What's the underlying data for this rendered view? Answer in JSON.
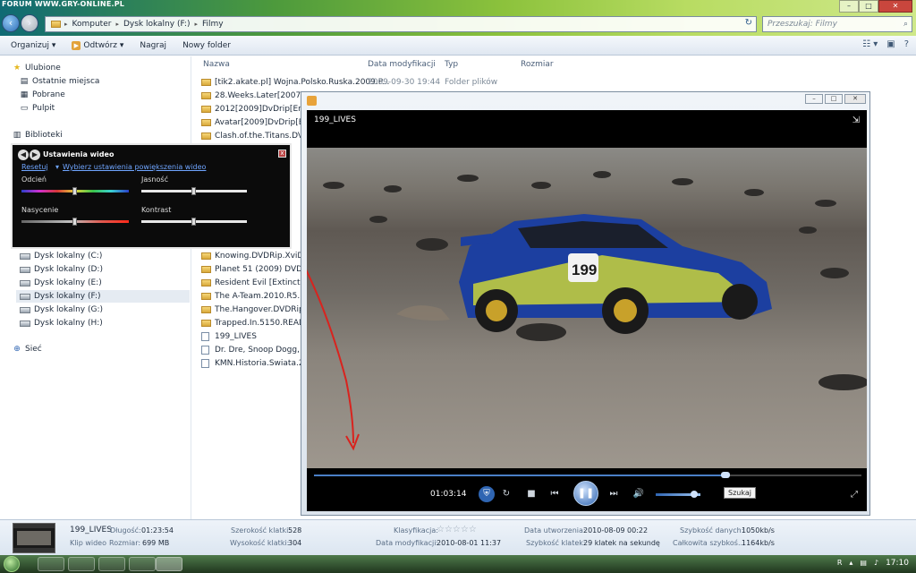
{
  "explorer": {
    "watermark": "FORUM WWW.GRY-ONLINE.PL",
    "breadcrumb": [
      "Komputer",
      "Dysk lokalny (F:)",
      "Filmy"
    ],
    "search_placeholder": "Przeszukaj: Filmy",
    "window_controls": [
      "–",
      "□",
      "✕"
    ],
    "toolbar": {
      "organize": "Organizuj ▾",
      "open": "Odtwórz ▾",
      "burn": "Nagraj",
      "new_folder": "Nowy folder"
    },
    "navpane": {
      "favorites": "Ulubione",
      "recent": "Ostatnie miejsca",
      "downloads": "Pobrane",
      "desktop": "Pulpit",
      "libraries": "Biblioteki",
      "drives": [
        "Dysk lokalny (C:)",
        "Dysk lokalny (D:)",
        "Dysk lokalny (E:)",
        "Dysk lokalny (F:)",
        "Dysk lokalny (G:)",
        "Dysk lokalny (H:)"
      ],
      "network": "Sieć"
    },
    "columns": {
      "name": "Nazwa",
      "modified": "Data modyfikacji",
      "type": "Typ",
      "size": "Rozmiar"
    },
    "files": [
      {
        "name": "[tik2.akate.pl] Wojna.Polsko.Ruska.2009.P...",
        "date": "2009-09-30 19:44",
        "type": "Folder plików",
        "kind": "folder"
      },
      {
        "name": "28.Weeks.Later[2007]DvDr",
        "date": "",
        "type": "",
        "kind": "folder"
      },
      {
        "name": "2012[2009]DvDrip[Eng]-F)",
        "date": "",
        "type": "",
        "kind": "folder"
      },
      {
        "name": "Avatar[2009]DvDrip[Eng]-",
        "date": "",
        "type": "",
        "kind": "folder"
      },
      {
        "name": "Clash.of.the.Titans.DVDRi",
        "date": "",
        "type": "",
        "kind": "folder"
      },
      {
        "name": "Knowing.DVDRip.XviD-Di",
        "date": "",
        "type": "",
        "kind": "folder"
      },
      {
        "name": "Planet 51 (2009) DVDRip X",
        "date": "",
        "type": "",
        "kind": "folder"
      },
      {
        "name": "Resident Evil [Extinction] (",
        "date": "",
        "type": "",
        "kind": "folder"
      },
      {
        "name": "The A-Team.2010.R5.LiNE",
        "date": "",
        "type": "",
        "kind": "folder"
      },
      {
        "name": "The.Hangover.DVDRip.Xvi",
        "date": "",
        "type": "",
        "kind": "folder"
      },
      {
        "name": "Trapped.In.5150.READNFO",
        "date": "",
        "type": "",
        "kind": "folder"
      },
      {
        "name": "199_LIVES",
        "date": "",
        "type": "",
        "kind": "file"
      },
      {
        "name": "Dr. Dre, Snoop Dogg, Ice C",
        "date": "",
        "type": "",
        "kind": "file"
      },
      {
        "name": "KMN.Historia.Swiata.2008",
        "date": "",
        "type": "",
        "kind": "file"
      }
    ]
  },
  "video_settings": {
    "title": "Ustawienia wideo",
    "reset": "Resetuj",
    "zoom_link": "Wybierz ustawienia powiększenia wideo",
    "labels": {
      "hue": "Odcień",
      "brightness": "Jasność",
      "saturation": "Nasycenie",
      "contrast": "Kontrast"
    },
    "levels": {
      "hue": 0.5,
      "brightness": 0.5,
      "saturation": 0.5,
      "contrast": 0.5
    }
  },
  "player": {
    "video_title": "199_LIVES",
    "time": "01:03:14",
    "seek_progress": 0.75,
    "volume_level": 0.85,
    "search_tooltip": "Szukaj",
    "controls": {
      "stop": "■",
      "prev": "⏮",
      "pause": "❚❚",
      "next": "⏭",
      "volume": "🔊"
    }
  },
  "details": {
    "name": "199_LIVES",
    "kind": "Klip wideo",
    "length_label": "Długość:",
    "length": "01:23:54",
    "size_label": "Rozmiar:",
    "size": "699 MB",
    "width_label": "Szerokość klatki:",
    "width": "528",
    "height_label": "Wysokość klatki:",
    "height": "304",
    "rating_label": "Klasyfikacja:",
    "modified_label": "Data modyfikacji:",
    "modified": "2010-08-01 11:37",
    "created_label": "Data utworzenia:",
    "created": "2010-08-09 00:22",
    "framerate_label": "Szybkość klatek:",
    "framerate": "29 klatek na sekundę",
    "datarate_label": "Szybkość danych:",
    "datarate": "1050kb/s",
    "totalrate_label": "Całkowita szybkoś...",
    "totalrate": "1164kb/s",
    "stars": "☆☆☆☆☆"
  },
  "taskbar": {
    "clock": "17:10",
    "lang": "R"
  },
  "colors": {
    "accent": "#2f65b2",
    "car_blue": "#1c3fa0",
    "annotation_red": "#d9231e"
  }
}
